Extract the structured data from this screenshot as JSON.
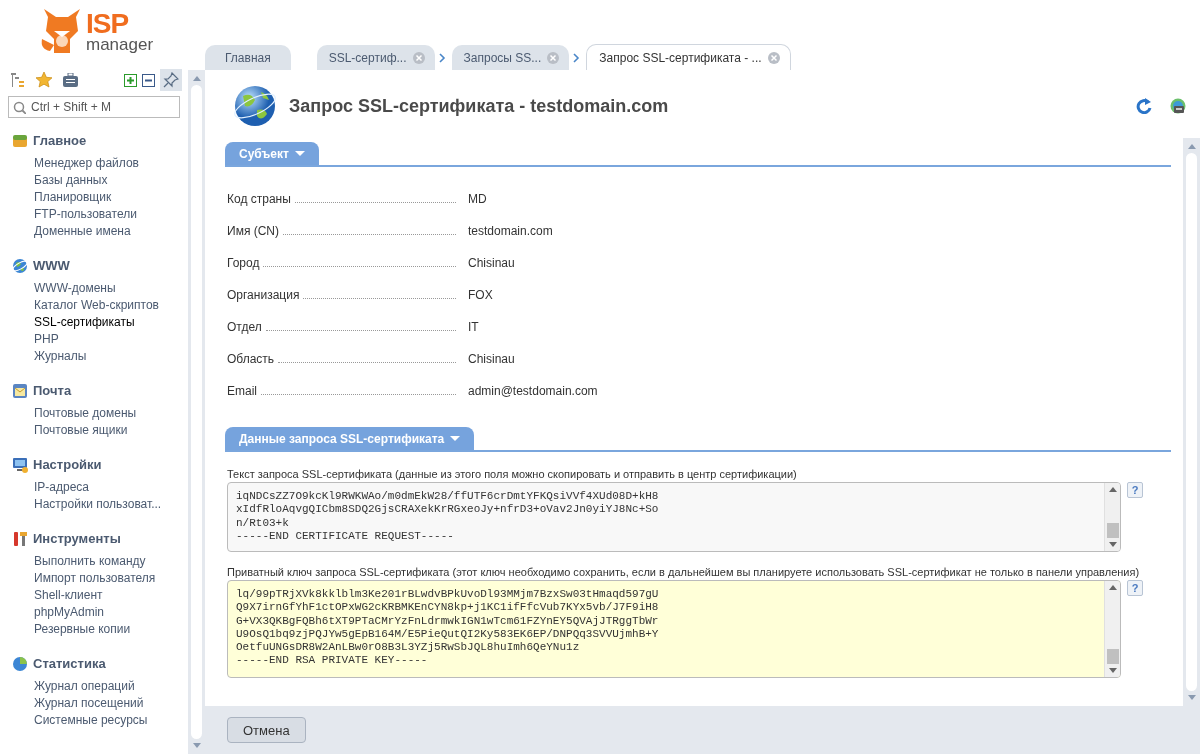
{
  "logo": {
    "brand": "ISP",
    "product": "manager"
  },
  "sidebar": {
    "search": {
      "placeholder": "Ctrl + Shift + M"
    },
    "groups": [
      {
        "title": "Главное",
        "items": [
          {
            "label": "Менеджер файлов",
            "selected": false
          },
          {
            "label": "Базы данных",
            "selected": false
          },
          {
            "label": "Планировщик",
            "selected": false
          },
          {
            "label": "FTP-пользователи",
            "selected": false
          },
          {
            "label": "Доменные имена",
            "selected": false
          }
        ]
      },
      {
        "title": "WWW",
        "items": [
          {
            "label": "WWW-домены",
            "selected": false
          },
          {
            "label": "Каталог Web-скриптов",
            "selected": false
          },
          {
            "label": "SSL-сертификаты",
            "selected": true
          },
          {
            "label": "PHP",
            "selected": false
          },
          {
            "label": "Журналы",
            "selected": false
          }
        ]
      },
      {
        "title": "Почта",
        "items": [
          {
            "label": "Почтовые домены",
            "selected": false
          },
          {
            "label": "Почтовые ящики",
            "selected": false
          }
        ]
      },
      {
        "title": "Настройки",
        "items": [
          {
            "label": "IP-адреса",
            "selected": false
          },
          {
            "label": "Настройки пользоват...",
            "selected": false
          }
        ]
      },
      {
        "title": "Инструменты",
        "items": [
          {
            "label": "Выполнить команду",
            "selected": false
          },
          {
            "label": "Импорт пользователя",
            "selected": false
          },
          {
            "label": "Shell-клиент",
            "selected": false
          },
          {
            "label": "phpMyAdmin",
            "selected": false
          },
          {
            "label": "Резервные копии",
            "selected": false
          }
        ]
      },
      {
        "title": "Статистика",
        "items": [
          {
            "label": "Журнал операций",
            "selected": false
          },
          {
            "label": "Журнал посещений",
            "selected": false
          },
          {
            "label": "Системные ресурсы",
            "selected": false
          }
        ]
      }
    ]
  },
  "tabs": [
    {
      "label": "Главная",
      "selected": false,
      "closable": false,
      "chevron_before": false
    },
    {
      "label": "SSL-сертиф...",
      "selected": false,
      "closable": true,
      "chevron_before": false
    },
    {
      "label": "Запросы SS...",
      "selected": false,
      "closable": true,
      "chevron_before": true
    },
    {
      "label": "Запрос SSL-сертификата - ...",
      "selected": true,
      "closable": true,
      "chevron_before": true
    }
  ],
  "page": {
    "title": "Запрос SSL-сертификата - testdomain.com",
    "sections": [
      {
        "title": "Субъект",
        "fields": [
          {
            "label": "Код страны",
            "value": "MD"
          },
          {
            "label": "Имя (CN)",
            "value": "testdomain.com"
          },
          {
            "label": "Город",
            "value": "Chisinau"
          },
          {
            "label": "Организация",
            "value": "FOX"
          },
          {
            "label": "Отдел",
            "value": "IT"
          },
          {
            "label": "Область",
            "value": "Chisinau"
          },
          {
            "label": "Email",
            "value": "admin@testdomain.com"
          }
        ]
      },
      {
        "title": "Данные запроса SSL-сертификата",
        "textareas": [
          {
            "label": "Текст запроса SSL-сертификата (данные из этого поля можно скопировать и отправить в центр сертификации)",
            "highlighted": false,
            "help": "?",
            "value": "iqNDCsZZ7O9kcKl9RWKWAo/m0dmEkW28/ffUTF6crDmtYFKQsiVVf4XUd08D+kH8\nxIdfRloAqvgQICbm8SDQ2GjsCRAXekKrRGxeoJy+nfrD3+oVav2Jn0yiYJ8Nc+So\nn/Rt03+k\n-----END CERTIFICATE REQUEST-----"
          },
          {
            "label": "Приватный ключ запроса SSL-сертификата (этот ключ необходимо сохранить, если в дальнейшем вы планируете использовать SSL-сертификат не только в панели управления)",
            "highlighted": true,
            "help": "?",
            "value": "lq/99pTRjXVk8kklblm3Ke201rBLwdvBPkUvoDl93MMjm7BzxSw03tHmaqd597gU\nQ9X7irnGfYhF1ctOPxWG2cKRBMKEnCYN8kp+j1KC1ifFfcVub7KYx5vb/J7F9iH8\nG+VX3QKBgFQBh6tXT9PTaCMrYzFnLdrmwkIGN1wTcm61FZYnEY5QVAjJTRggTbWr\nU9OsQ1bq9zjPQJYw5gEpB164M/E5PieQutQI2Ky583EK6EP/DNPQq3SVVUjmhB+Y\nOetfuUNGsDR8W2AnLBw0rO8B3L3YZj5RwSbJQL8huImh6QeYNu1z\n-----END RSA PRIVATE KEY-----"
          }
        ]
      }
    ],
    "buttons": [
      "Отмена"
    ]
  }
}
